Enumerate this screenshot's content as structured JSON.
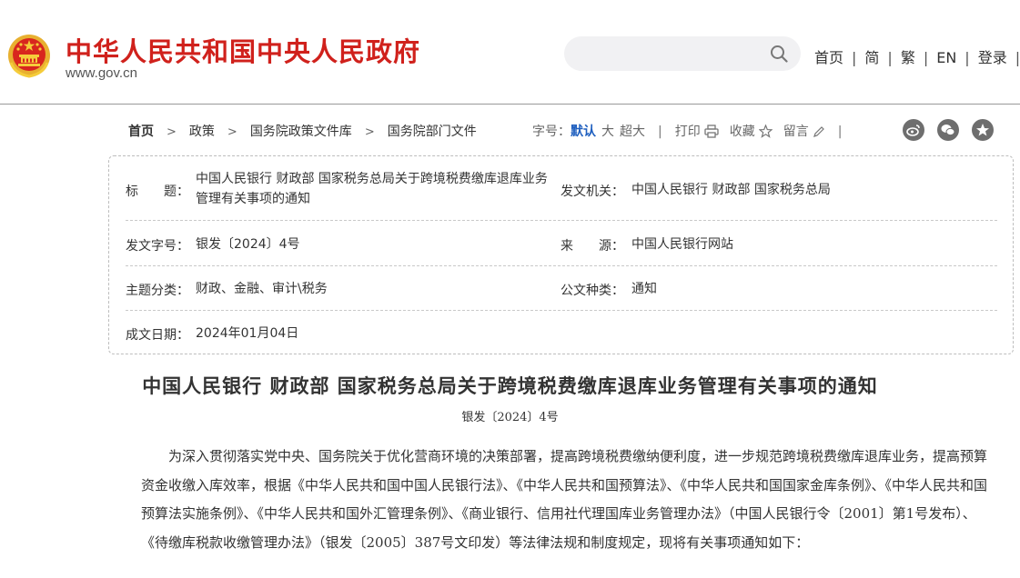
{
  "header": {
    "site_title": "中华人民共和国中央人民政府",
    "site_url": "www.gov.cn",
    "search_placeholder": "",
    "links": [
      "首页",
      "简",
      "繁",
      "EN",
      "登录"
    ]
  },
  "breadcrumb": {
    "items": [
      "首页",
      "政策",
      "国务院政策文件库",
      "国务院部门文件"
    ]
  },
  "tools": {
    "font_label": "字号：",
    "font_default": "默认",
    "font_large": "大",
    "font_xlarge": "超大",
    "print": "打印",
    "favorite": "收藏",
    "comment": "留言"
  },
  "meta": {
    "title_label": "标　　题：",
    "title_value": "中国人民银行 财政部 国家税务总局关于跨境税费缴库退库业务管理有关事项的通知",
    "issuer_label": "发文机关：",
    "issuer_value": "中国人民银行 财政部 国家税务总局",
    "doc_no_label": "发文字号：",
    "doc_no_value": "银发〔2024〕4号",
    "source_label": "来　　源：",
    "source_value": "中国人民银行网站",
    "topic_label": "主题分类：",
    "topic_value": "财政、金融、审计\\税务",
    "type_label": "公文种类：",
    "type_value": "通知",
    "date_label": "成文日期：",
    "date_value": "2024年01月04日"
  },
  "article": {
    "title": "中国人民银行 财政部 国家税务总局关于跨境税费缴库退库业务管理有关事项的通知",
    "doc_no": "银发〔2024〕4号",
    "paragraph": "为深入贯彻落实党中央、国务院关于优化营商环境的决策部署，提高跨境税费缴纳便利度，进一步规范跨境税费缴库退库业务，提高预算资金收缴入库效率，根据《中华人民共和国中国人民银行法》、《中华人民共和国预算法》、《中华人民共和国国家金库条例》、《中华人民共和国预算法实施条例》、《中华人民共和国外汇管理条例》、《商业银行、信用社代理国库业务管理办法》（中国人民银行令〔2001〕第1号发布）、《待缴库税款收缴管理办法》（银发〔2005〕387号文印发）等法律法规和制度规定，现将有关事项通知如下："
  },
  "colors": {
    "brand_red": "#d0211c",
    "link_blue": "#1f5fbf"
  }
}
